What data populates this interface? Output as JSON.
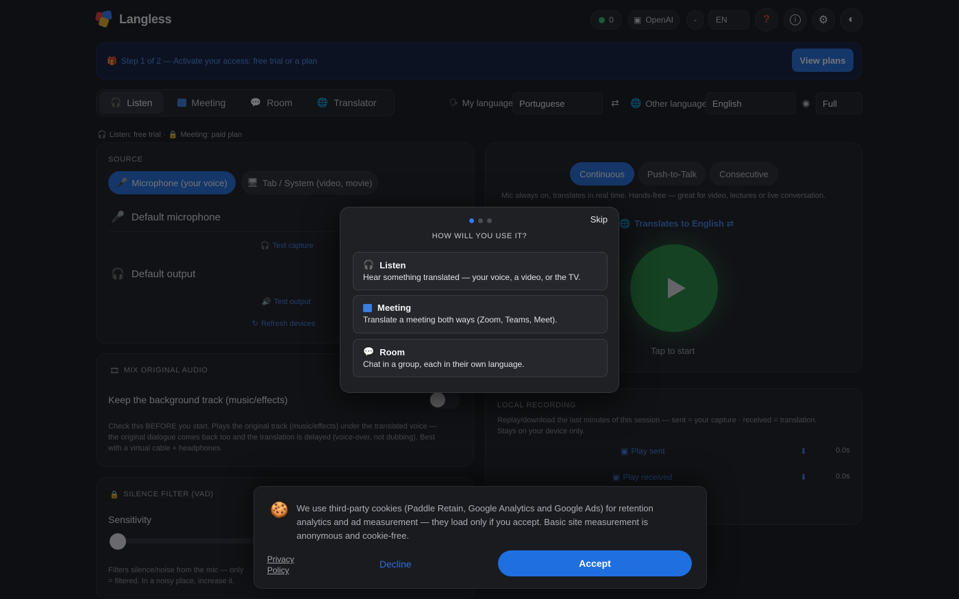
{
  "app": {
    "name": "Langless"
  },
  "header": {
    "status_count": "0",
    "provider": "OpenAI",
    "dash": "-",
    "lang_code": "EN",
    "help_symbol": "?",
    "info_symbol": "i",
    "settings_symbol": "⚙",
    "theme_symbol": "◐"
  },
  "banner": {
    "text": "Step 1 of 2 — Activate your access: free trial or a plan",
    "button": "View plans"
  },
  "tabs": [
    {
      "label": "Listen",
      "icon": "headphones-icon",
      "active": true
    },
    {
      "label": "Meeting",
      "icon": "meeting-icon",
      "active": false
    },
    {
      "label": "Room",
      "icon": "chat-bubble-icon",
      "active": false
    },
    {
      "label": "Translator",
      "icon": "globe-icon",
      "active": false
    }
  ],
  "languages": {
    "my_label": "My language",
    "my_value": "Portuguese",
    "swap_symbol": "⇄",
    "other_label": "Other language",
    "other_value": "English",
    "view_value": "Full"
  },
  "access_info": {
    "listen": "Listen: free trial ·",
    "meeting": "Meeting: paid plan"
  },
  "source": {
    "heading": "SOURCE",
    "chip_mic": "Microphone (your voice)",
    "chip_tab": "Tab / System (video, movie)",
    "default_mic": "Default microphone",
    "test_capture": "Test capture",
    "default_output": "Default output",
    "test_output": "Test output",
    "refresh": "Refresh devices"
  },
  "mix": {
    "heading": "MIX ORIGINAL AUDIO",
    "label": "Keep the background track (music/effects)",
    "desc_1": "Check this BEFORE you start. Plays the original track (music/effects) under the translated voice —",
    "desc_2": "the original dialogue comes back too and the translation is delayed (voice-over, not dubbing). Best",
    "desc_3": "with a virtual cable + headphones.",
    "enabled": false
  },
  "vad": {
    "heading": "SILENCE FILTER (VAD)",
    "label": "Sensitivity",
    "desc_1": "Filters silence/noise from the mic — only",
    "desc_2": "= filtered. In a noisy place, increase it.",
    "level": 0
  },
  "modes": {
    "continuous": "Continuous",
    "ptt": "Push-to-Talk",
    "consecutive": "Consecutive",
    "desc": "Mic always on, translates in real time. Hands-free — great for video, lectures or live conversation.",
    "translates_to": "Translates to English ⇄",
    "tap": "Tap to start"
  },
  "recording": {
    "heading": "LOCAL RECORDING",
    "desc_1": "Replay/download the last minutes of this session — sent = your capture · received = translation.",
    "desc_2": "Stays on your device only.",
    "play_sent": "Play sent",
    "play_received": "Play received",
    "sent_dur": "0.0s",
    "received_dur": "0.0s"
  },
  "onboarding": {
    "skip": "Skip",
    "title": "HOW WILL YOU USE IT?",
    "options": [
      {
        "title": "Listen",
        "desc": "Hear something translated — your voice, a video, or the TV."
      },
      {
        "title": "Meeting",
        "desc": "Translate a meeting both ways (Zoom, Teams, Meet)."
      },
      {
        "title": "Room",
        "desc": "Chat in a group, each in their own language."
      }
    ]
  },
  "cookie": {
    "text_1": "We use third-party cookies (Paddle Retain, Google Analytics and Google Ads) for retention",
    "text_2": "analytics and ad measurement — they load only if you accept. Basic site measurement is",
    "text_3": "anonymous and cookie-free.",
    "privacy_1": "Privacy",
    "privacy_2": "Policy",
    "decline": "Decline",
    "accept": "Accept"
  },
  "colors": {
    "accent": "#1f6fe0",
    "play": "#1f8a3c",
    "banner": "#0b1a3a"
  }
}
